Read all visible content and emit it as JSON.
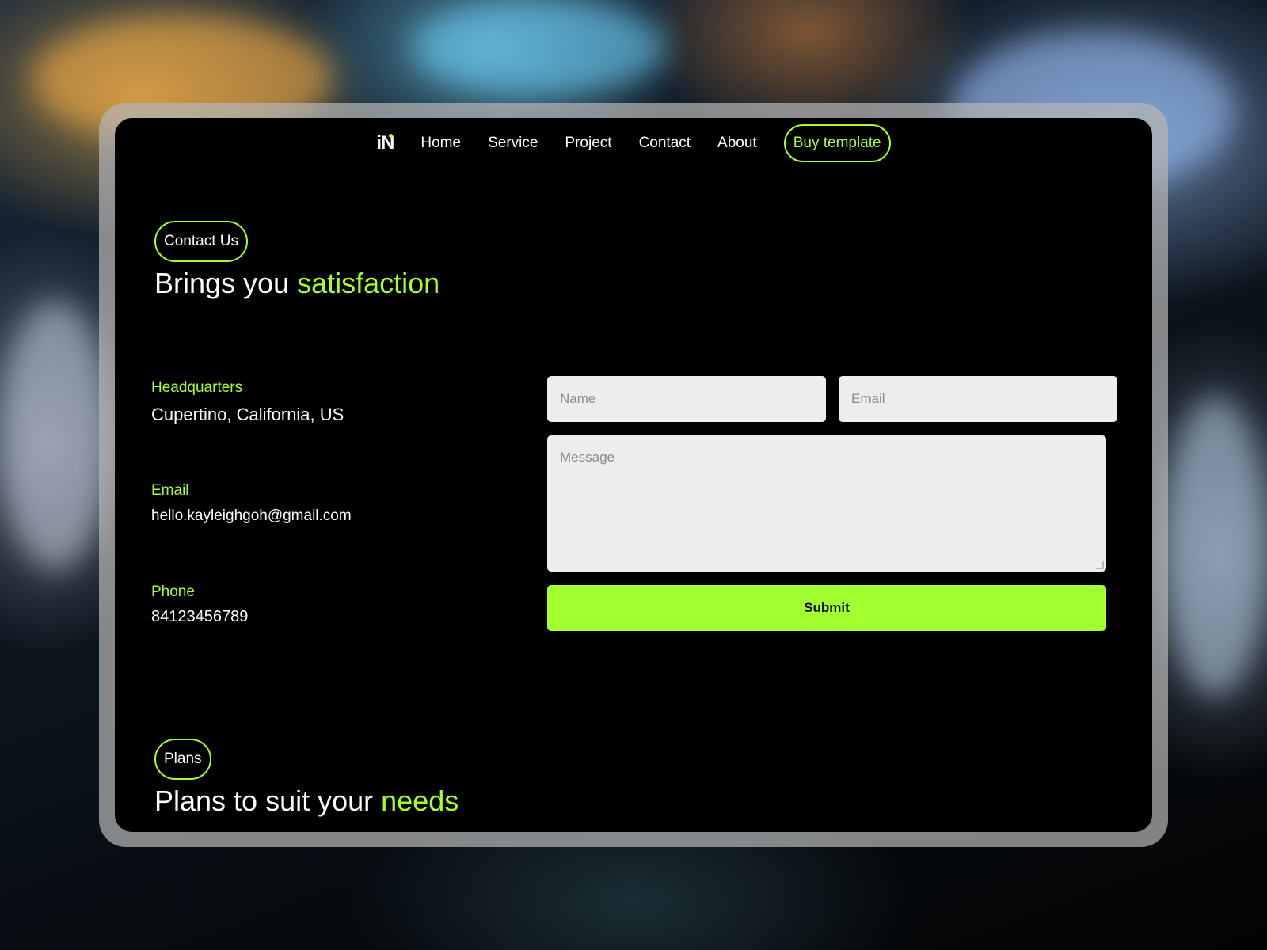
{
  "nav": {
    "logo": "iN",
    "links": [
      "Home",
      "Service",
      "Project",
      "Contact",
      "About"
    ],
    "cta": "Buy template"
  },
  "contact": {
    "pill": "Contact Us",
    "heading_main": "Brings you ",
    "heading_accent": "satisfaction",
    "info": [
      {
        "label": "Headquarters",
        "value": "Cupertino, California, US"
      },
      {
        "label": "Email",
        "value": "hello.kayleighgoh@gmail.com"
      },
      {
        "label": "Phone",
        "value": "84123456789"
      }
    ]
  },
  "form": {
    "name_placeholder": "Name",
    "email_placeholder": "Email",
    "message_placeholder": "Message",
    "submit_label": "Submit"
  },
  "plans": {
    "pill": "Plans",
    "heading_main": "Plans to suit your ",
    "heading_accent": "needs"
  },
  "colors": {
    "accent": "#a3ff2f",
    "panel_bg": "#000000",
    "field_bg": "#ededed"
  }
}
